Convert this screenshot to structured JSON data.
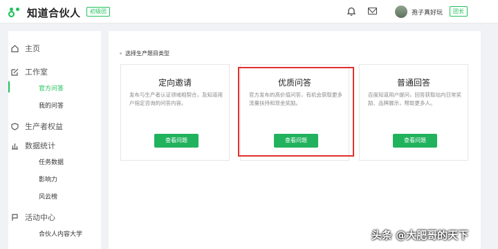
{
  "app": {
    "brand": "知道合伙人",
    "level_badge": "初级团",
    "username": "孢子真好玩",
    "role_badge": "团长"
  },
  "sidebar": {
    "home": "主页",
    "studio": "工作室",
    "studio_items": [
      "官方问答",
      "我的问答"
    ],
    "rights": "生产者权益",
    "stats": "数据统计",
    "stats_items": [
      "任务数据",
      "影响力",
      "风云榜"
    ],
    "activity": "活动中心",
    "activity_items": [
      "合伙人内容大学"
    ]
  },
  "main": {
    "section_label": "选择生产题目类型",
    "cards": [
      {
        "title": "定向邀请",
        "desc": "发布与生产者认证领域相契合，及知道用户指定咨询的问答内容。",
        "button": "查看问题"
      },
      {
        "title": "优质问答",
        "desc": "官方发布的高价值问答，有机会获取更多流量扶持和现金奖励。",
        "button": "查看问题"
      },
      {
        "title": "普通回答",
        "desc": "百度知道用户提问，回答获取站内日常奖励、品牌展示，帮助更多人。",
        "button": "查看问题"
      }
    ]
  },
  "watermark": "头条 @大肥哥的天下",
  "colors": {
    "accent": "#1fc25b",
    "button": "#21b25d",
    "highlight": "#e0302a"
  }
}
